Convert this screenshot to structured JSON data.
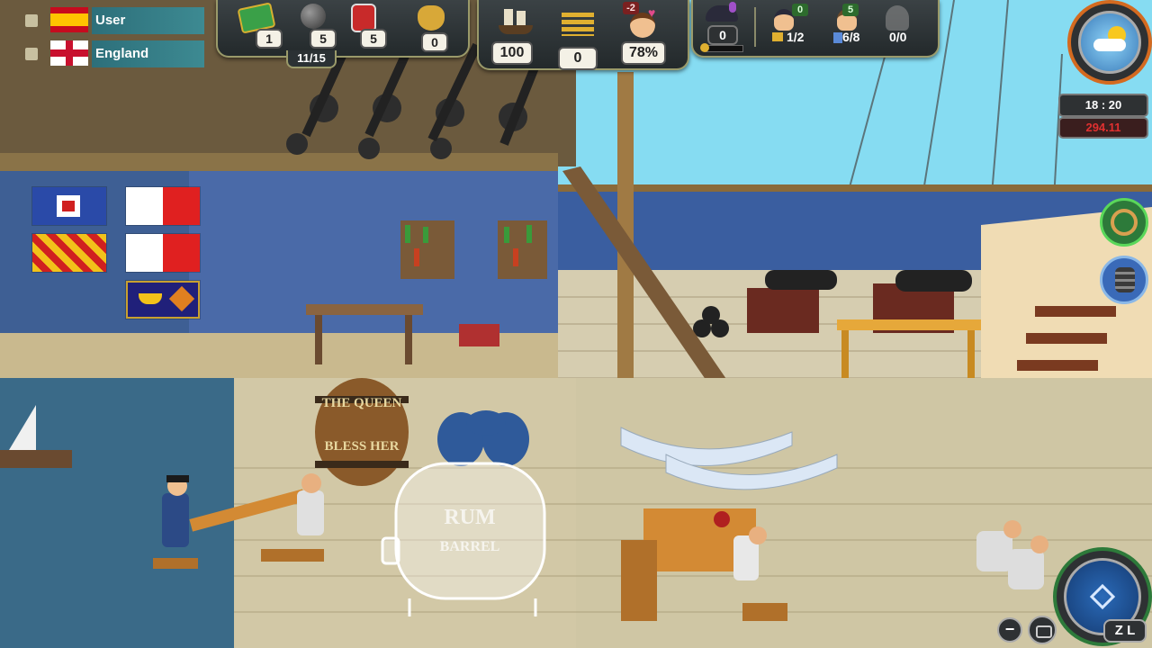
{
  "players": [
    {
      "name": "User",
      "flag": "spain-flag-icon"
    },
    {
      "name": "England",
      "flag": "union-flag-icon"
    }
  ],
  "resources": {
    "cash": "1",
    "cannonballs": "5",
    "powder": "5",
    "gold_bag": "0",
    "capacity": "11/15"
  },
  "ship": {
    "ships": "100",
    "rank": "0",
    "morale": "78%",
    "morale_delta": "-2"
  },
  "crew": {
    "admiral": "0",
    "officer_badge": "0",
    "officers": "1/2",
    "sailors_badge": "5",
    "sailors": "6/8",
    "marines": "0/0"
  },
  "clock": {
    "time": "18 : 20",
    "coin": "294.11"
  },
  "hints": {
    "minus": "−",
    "zl": "Z L"
  },
  "scene_text": {
    "barrel_top": "THE QUEEN",
    "barrel_bottom": "BLESS HER",
    "rum_top": "RUM",
    "rum_bottom": "BARREL"
  },
  "colors": {
    "hud_border": "#9a9a6a",
    "name_box": "#3d8a92",
    "weather_ring": "#d46a20",
    "compass_ring": "#2d7a3a"
  }
}
